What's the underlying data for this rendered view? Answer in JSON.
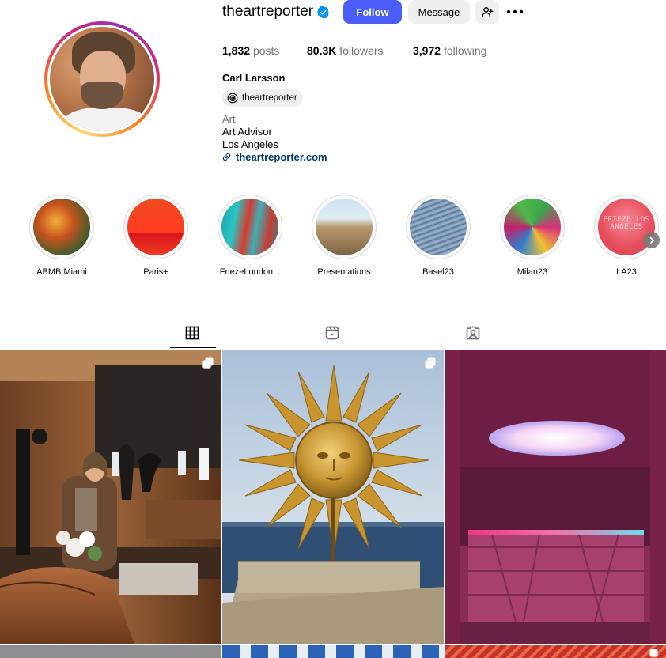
{
  "profile": {
    "username": "theartreporter",
    "verified": true,
    "buttons": {
      "follow": "Follow",
      "message": "Message"
    },
    "stats": {
      "posts_count": "1,832",
      "posts_label": "posts",
      "followers_count": "80.3K",
      "followers_label": "followers",
      "following_count": "3,972",
      "following_label": "following"
    },
    "full_name": "Carl Larsson",
    "threads_handle": "theartreporter",
    "bio": {
      "category": "Art",
      "line1": "Art Advisor",
      "line2": "Los Angeles",
      "link": "theartreporter.com"
    }
  },
  "highlights": [
    {
      "label": "ABMB Miami"
    },
    {
      "label": "Paris+"
    },
    {
      "label": "FriezeLondon..."
    },
    {
      "label": "Presentations"
    },
    {
      "label": "Basel23"
    },
    {
      "label": "Milan23"
    },
    {
      "label": "LA23"
    }
  ],
  "highlight_image_text": "FRIEZE LOS ANGELES",
  "tabs": [
    {
      "icon": "grid-icon",
      "active": true
    },
    {
      "icon": "reels-icon",
      "active": false
    },
    {
      "icon": "tagged-icon",
      "active": false
    }
  ],
  "colors": {
    "follow_button": "#4a5df9",
    "link": "#00376b",
    "secondary_text": "#737373"
  }
}
